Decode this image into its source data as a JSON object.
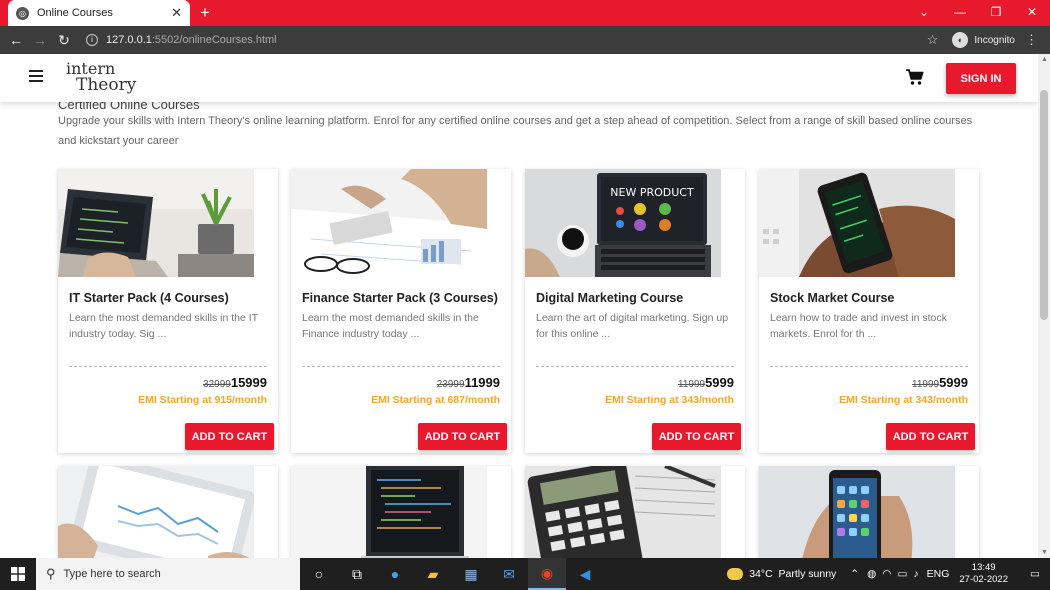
{
  "browser": {
    "tab_title": "Online Courses",
    "url_host": "127.0.0.1",
    "url_rest": ":5502/onlineCourses.html",
    "profile": "Incognito"
  },
  "header": {
    "logo_line1": "intern",
    "logo_line2": "Theory",
    "signin_label": "SIGN IN"
  },
  "section": {
    "title": "Certified Online Courses",
    "description": "Upgrade your skills with Intern Theory's online learning platform. Enrol for any certified online courses and get a step ahead of competition. Select from a range of skill based online courses and kickstart your career"
  },
  "courses": [
    {
      "title": "IT Starter Pack (4 Courses)",
      "desc": "Learn the most demanded skills in the IT industry today. Sig ...",
      "old_price": "32999",
      "price": "15999",
      "emi": "EMI Starting at 915/month",
      "cta": "ADD TO CART"
    },
    {
      "title": "Finance Starter Pack (3 Courses)",
      "desc": "Learn the most demanded skills in the Finance industry today ...",
      "old_price": "23999",
      "price": "11999",
      "emi": "EMI Starting at 687/month",
      "cta": "ADD TO CART"
    },
    {
      "title": "Digital Marketing Course",
      "desc": "Learn the art of digital marketing. Sign up for this online ...",
      "old_price": "11999",
      "price": "5999",
      "emi": "EMI Starting at 343/month",
      "cta": "ADD TO CART"
    },
    {
      "title": "Stock Market Course",
      "desc": "Learn how to trade and invest in stock markets. Enrol for th ...",
      "old_price": "11999",
      "price": "5999",
      "emi": "EMI Starting at 343/month",
      "cta": "ADD TO CART"
    }
  ],
  "thumb_text": {
    "new_product": "NEW PRODUCT"
  },
  "taskbar": {
    "search_placeholder": "Type here to search",
    "temperature": "34°C",
    "weather": "Partly sunny",
    "language": "ENG",
    "time": "13:49",
    "date": "27-02-2022"
  },
  "colors": {
    "brand_red": "#e8192c",
    "emi_orange": "#f5a623"
  }
}
